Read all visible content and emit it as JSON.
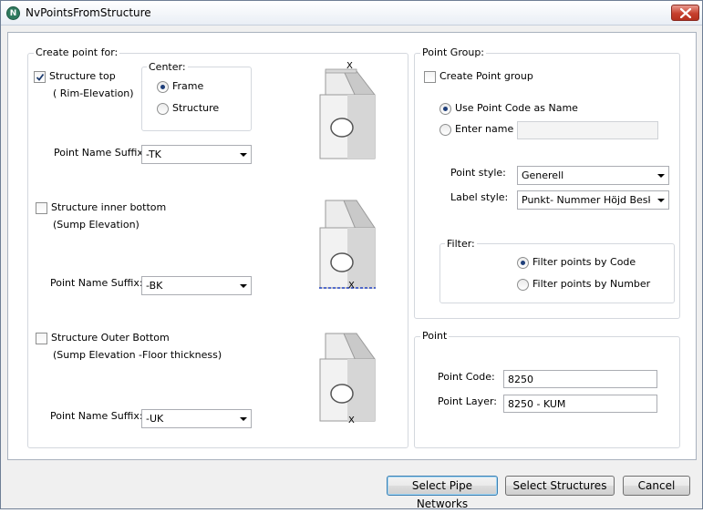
{
  "window": {
    "title": "NvPointsFromStructure",
    "icon_letter": "N"
  },
  "create_point": {
    "legend": "Create point for:",
    "top": {
      "label": "Structure top",
      "sublabel": "( Rim-Elevation)",
      "checked": true,
      "suffix_label": "Point Name Suffix:",
      "suffix_value": "-TK"
    },
    "center": {
      "legend": "Center:",
      "frame_label": "Frame",
      "structure_label": "Structure",
      "selected": "frame"
    },
    "inner_bottom": {
      "label": "Structure inner bottom",
      "sublabel": "(Sump Elevation)",
      "checked": false,
      "suffix_label": "Point Name Suffix:",
      "suffix_value": "-BK"
    },
    "outer_bottom": {
      "label": "Structure Outer Bottom",
      "sublabel": "(Sump Elevation -Floor thickness)",
      "checked": false,
      "suffix_label": "Point Name Suffix:",
      "suffix_value": "-UK"
    },
    "marker": "X"
  },
  "point_group": {
    "legend": "Point Group:",
    "create_label": "Create Point group",
    "create_checked": false,
    "use_code_label": "Use Point Code as Name",
    "enter_name_label": "Enter name",
    "name_selected": "use_code",
    "enter_name_value": "",
    "point_style_label": "Point style:",
    "point_style_value": "Generell",
    "label_style_label": "Label style:",
    "label_style_value": "Punkt- Nummer Höjd Beskrivning",
    "filter": {
      "legend": "Filter:",
      "by_code_label": "Filter points by Code",
      "by_number_label": "Filter points by Number",
      "selected": "code"
    }
  },
  "point": {
    "legend": "Point",
    "code_label": "Point Code:",
    "code_value": "8250",
    "layer_label": "Point Layer:",
    "layer_value": "8250 - KUM"
  },
  "buttons": {
    "select_pipe_networks": "Select Pipe Networks",
    "select_structures": "Select Structures",
    "cancel": "Cancel"
  },
  "colors": {
    "sump_line": "#1f3fbf",
    "radio_dot": "#1f3f7a",
    "close_button": "#c7402e"
  }
}
